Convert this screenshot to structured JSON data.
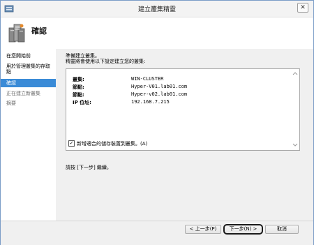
{
  "window": {
    "title": "建立叢集精靈",
    "close_label": "✕"
  },
  "header": {
    "title": "確認"
  },
  "sidebar": {
    "items": [
      {
        "label": "在您開始前"
      },
      {
        "label": "用於管理叢集的存取點"
      },
      {
        "label": "確認"
      },
      {
        "label": "正在建立新叢集"
      },
      {
        "label": "摘要"
      }
    ]
  },
  "content": {
    "intro_line1": "準備建立叢集。",
    "intro_line2": "精靈將會使用以下設定建立您的叢集:",
    "summary": [
      {
        "key": "叢集:",
        "value": "WIN-CLUSTER"
      },
      {
        "key": "節點:",
        "value": "Hyper-V01.lab01.com"
      },
      {
        "key": "節點:",
        "value": "Hyper-v02.lab01.com"
      },
      {
        "key": "IP 位址:",
        "value": "192.168.7.215"
      }
    ],
    "checkbox_label": "新增適合的儲存裝置到叢集。(A)",
    "checkbox_checked": true,
    "instruction": "請按 [下一步] 繼續。"
  },
  "buttons": {
    "back": "< 上一步(P)",
    "next": "下一步(N) >",
    "cancel": "取消"
  },
  "colors": {
    "selection": "#3a8bd7",
    "content_bg": "#f0f0f0"
  }
}
